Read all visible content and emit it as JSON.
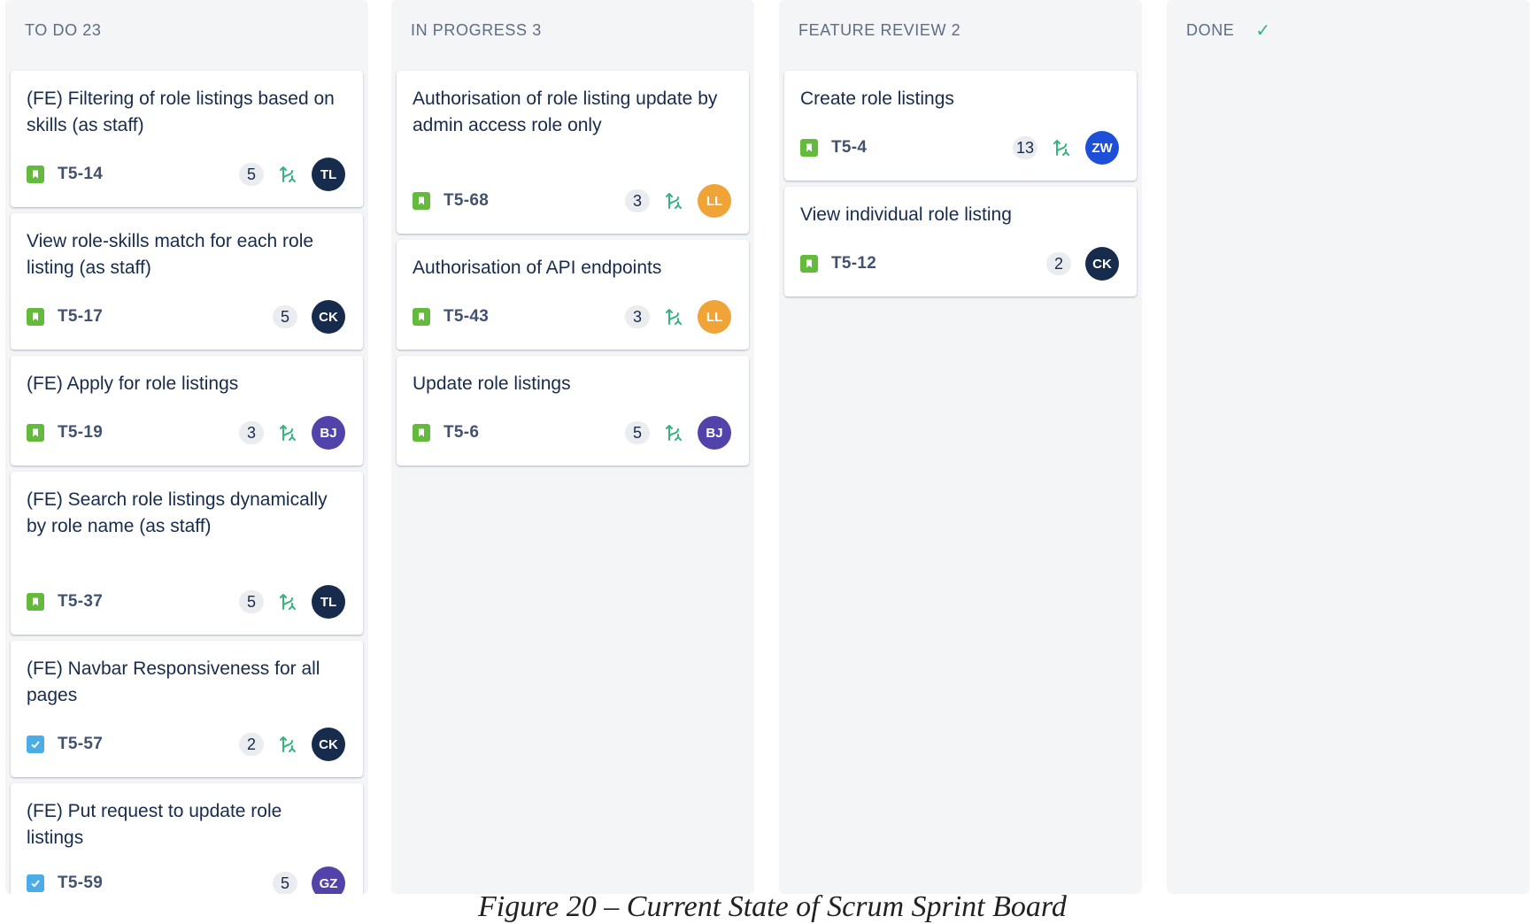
{
  "columns": [
    {
      "title": "TO DO 23",
      "cards": [
        {
          "title": "(FE) Filtering of role listings based on skills (as staff)",
          "type": "story-icon",
          "key": "T5-14",
          "points": "5",
          "has_branch": true,
          "assignee": "TL",
          "avatar_color": "#172b4d"
        },
        {
          "title": "View role-skills match for each role listing (as staff)",
          "type": "story-icon",
          "key": "T5-17",
          "points": "5",
          "has_branch": false,
          "assignee": "CK",
          "avatar_color": "#172b4d"
        },
        {
          "title": "(FE) Apply for role listings",
          "type": "story-icon",
          "key": "T5-19",
          "points": "3",
          "has_branch": true,
          "assignee": "BJ",
          "avatar_color": "#5243aa"
        },
        {
          "title": "(FE) Search role listings dynamically by role name (as staff)",
          "type": "story-icon",
          "key": "T5-37",
          "points": "5",
          "has_branch": true,
          "assignee": "TL",
          "avatar_color": "#172b4d"
        },
        {
          "title": "(FE) Navbar Responsiveness for all pages",
          "type": "task-icon",
          "key": "T5-57",
          "points": "2",
          "has_branch": true,
          "assignee": "CK",
          "avatar_color": "#172b4d"
        },
        {
          "title": "(FE) Put request to update role listings",
          "type": "task-icon",
          "key": "T5-59",
          "points": "5",
          "has_branch": false,
          "assignee": "GZ",
          "avatar_color": "#5243aa"
        }
      ]
    },
    {
      "title": "IN PROGRESS 3",
      "cards": [
        {
          "title": "Authorisation of role listing update by admin access role only",
          "type": "story-icon",
          "key": "T5-68",
          "points": "3",
          "has_branch": true,
          "assignee": "LL",
          "avatar_color": "#f0a336"
        },
        {
          "title": "Authorisation of API endpoints",
          "type": "story-icon",
          "key": "T5-43",
          "points": "3",
          "has_branch": true,
          "assignee": "LL",
          "avatar_color": "#f0a336"
        },
        {
          "title": "Update role listings",
          "type": "story-icon",
          "key": "T5-6",
          "points": "5",
          "has_branch": true,
          "assignee": "BJ",
          "avatar_color": "#5243aa"
        }
      ]
    },
    {
      "title": "FEATURE REVIEW 2",
      "cards": [
        {
          "title": "Create role listings",
          "type": "story-icon",
          "key": "T5-4",
          "points": "13",
          "has_branch": true,
          "assignee": "ZW",
          "avatar_color": "#1d4fd8"
        },
        {
          "title": "View individual role listing",
          "type": "story-icon",
          "key": "T5-12",
          "points": "2",
          "has_branch": false,
          "assignee": "CK",
          "avatar_color": "#172b4d"
        }
      ]
    },
    {
      "title": "DONE",
      "show_check": true,
      "cards": []
    }
  ],
  "caption": "Figure 20 – Current State of Scrum Sprint Board",
  "colors": {
    "story": "#63ba3c",
    "task": "#4bade8",
    "branch": "#36b37e",
    "column_bg": "#f4f5f7"
  }
}
